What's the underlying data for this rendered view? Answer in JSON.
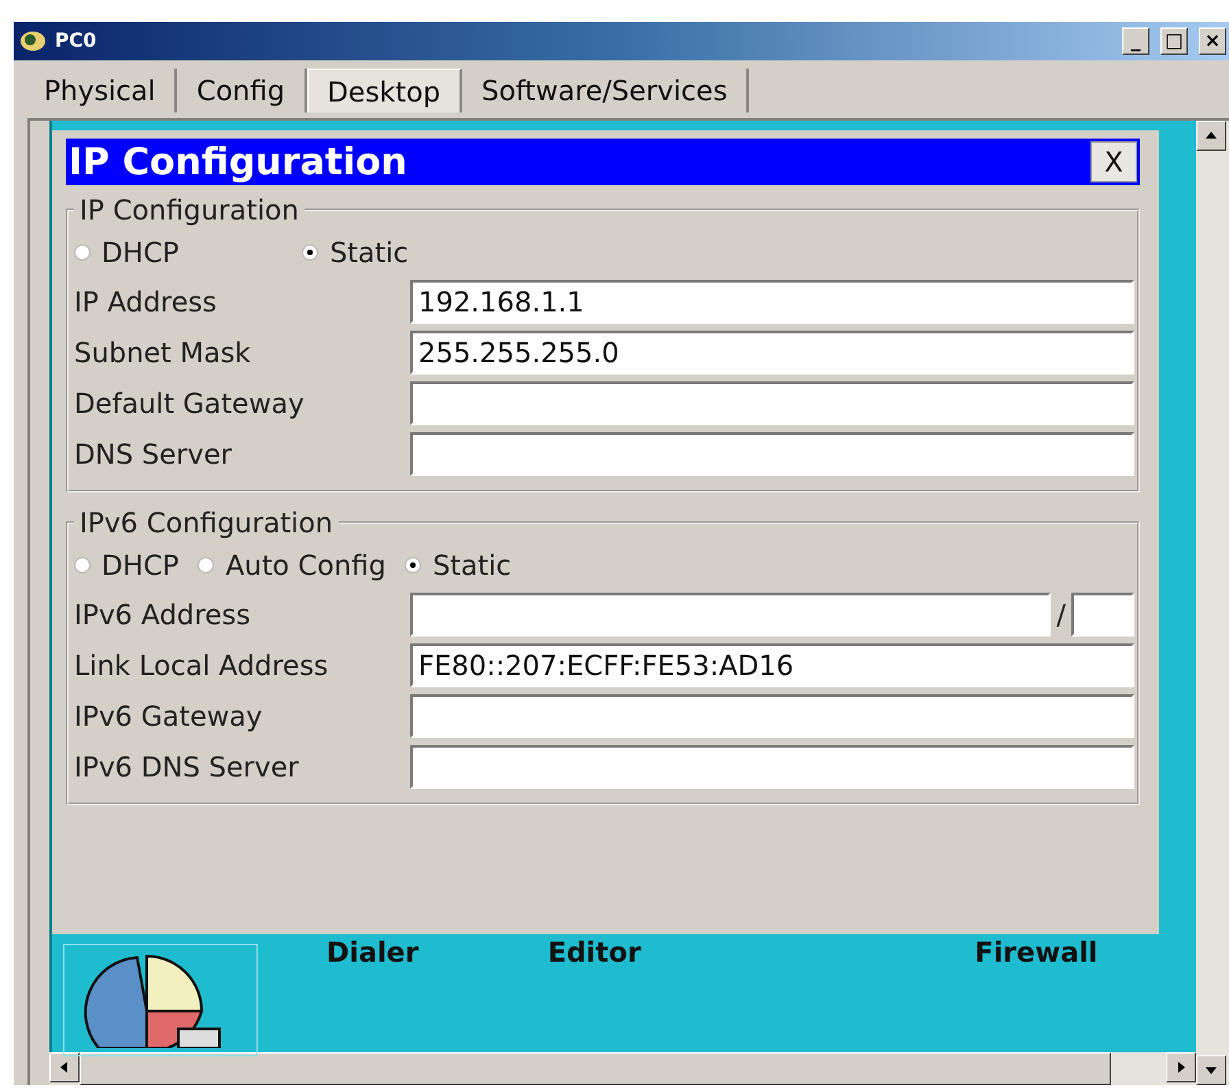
{
  "window": {
    "title": "PC0",
    "controls": [
      "_",
      "□",
      "×"
    ]
  },
  "tabs": [
    {
      "label": "Physical",
      "selected": false
    },
    {
      "label": "Config",
      "selected": false
    },
    {
      "label": "Desktop",
      "selected": true
    },
    {
      "label": "Software/Services",
      "selected": false
    }
  ],
  "dialog": {
    "title": "IP Configuration",
    "close": "X",
    "sections": [
      {
        "legend": "IP Configuration",
        "modes": [
          {
            "label": "DHCP",
            "selected": false
          },
          {
            "label": "Static",
            "selected": true
          }
        ],
        "fields": [
          {
            "kind": "plain",
            "label": "IP Address",
            "value": "192.168.1.1"
          },
          {
            "kind": "plain",
            "label": "Subnet Mask",
            "value": "255.255.255.0"
          },
          {
            "kind": "plain",
            "label": "Default Gateway"
          },
          {
            "kind": "plain",
            "label": "DNS Server"
          }
        ]
      },
      {
        "legend": "IPv6 Configuration",
        "modes": [
          {
            "label": "DHCP",
            "selected": false
          },
          {
            "label": "Auto Config",
            "selected": false
          },
          {
            "label": "Static",
            "selected": true
          }
        ],
        "fields": [
          {
            "kind": "prefix",
            "label": "IPv6 Address",
            "separator": "/"
          },
          {
            "kind": "plain",
            "label": "Link Local Address",
            "value": "FE80::207:ECFF:FE53:AD16"
          },
          {
            "kind": "plain",
            "label": "IPv6 Gateway"
          },
          {
            "kind": "plain",
            "label": "IPv6 DNS Server"
          }
        ]
      }
    ]
  },
  "desktop": {
    "apps": [
      {
        "label": "Dialer"
      },
      {
        "label": "Editor"
      },
      {
        "label": "Firewall"
      }
    ]
  }
}
